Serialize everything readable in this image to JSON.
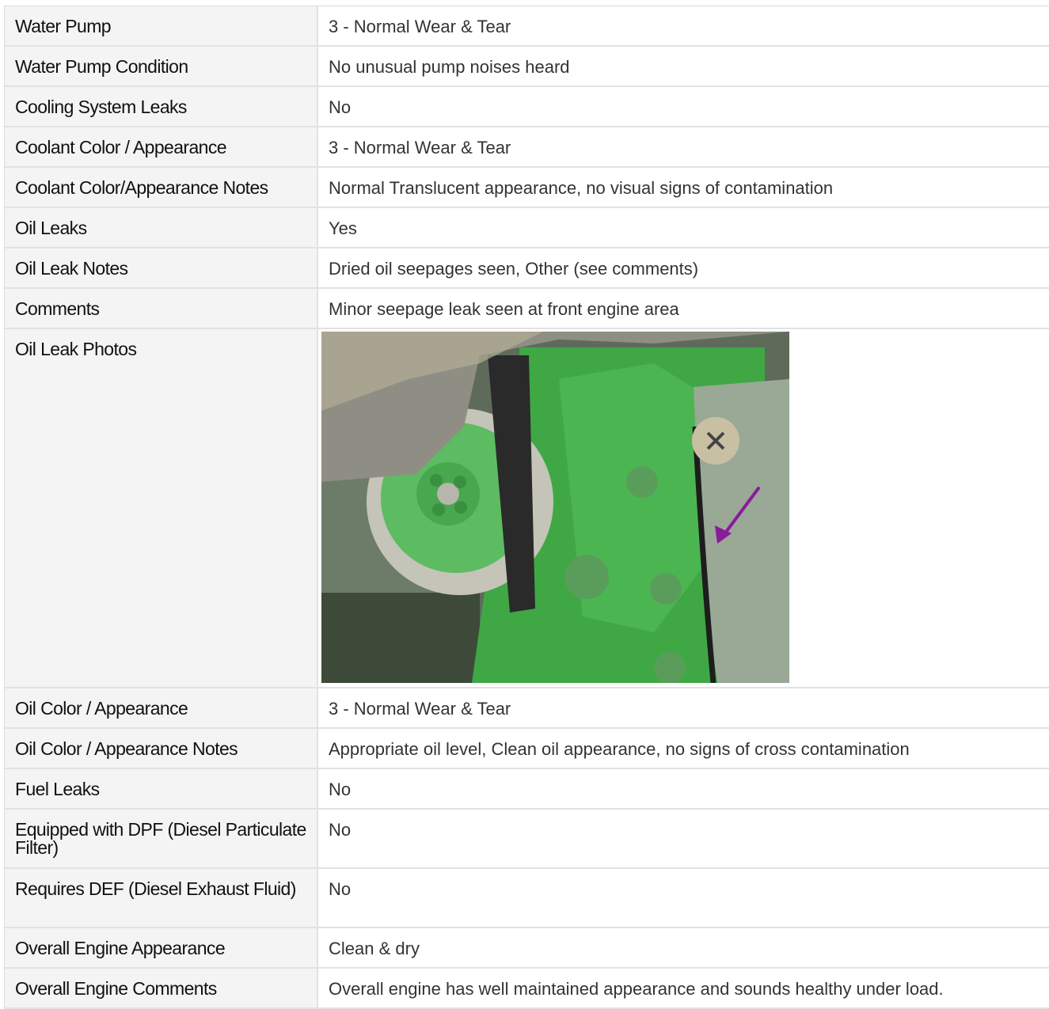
{
  "rows": [
    {
      "label": "Water Pump",
      "value": "3 - Normal Wear & Tear"
    },
    {
      "label": "Water Pump Condition",
      "value": "No unusual pump noises heard"
    },
    {
      "label": "Cooling System Leaks",
      "value": "No"
    },
    {
      "label": "Coolant Color / Appearance",
      "value": "3 - Normal Wear & Tear"
    },
    {
      "label": "Coolant Color/Appearance Notes",
      "value": "Normal Translucent appearance, no visual signs of contamination"
    },
    {
      "label": "Oil Leaks",
      "value": "Yes"
    },
    {
      "label": "Oil Leak Notes",
      "value": "Dried oil seepages seen, Other (see comments)"
    },
    {
      "label": "Comments",
      "value": "Minor seepage leak seen at front engine area"
    },
    {
      "label": "Oil Leak Photos",
      "photo": "engine-oil-leak-photo"
    },
    {
      "label": "Oil Color / Appearance",
      "value": "3 - Normal Wear & Tear"
    },
    {
      "label": "Oil Color / Appearance Notes",
      "value": "Appropriate oil level, Clean oil appearance, no signs of cross contamination"
    },
    {
      "label": "Fuel Leaks",
      "value": "No"
    },
    {
      "label": "Equipped with DPF (Diesel Particulate Filter)",
      "value": "No"
    },
    {
      "label": "Requires DEF (Diesel Exhaust Fluid)",
      "value": "No"
    },
    {
      "label": "Overall Engine Appearance",
      "value": "Clean & dry"
    },
    {
      "label": "Overall Engine Comments",
      "value": "Overall engine has well maintained appearance and sounds healthy under load."
    }
  ],
  "colors": {
    "label_bg": "#f4f4f4",
    "border": "#e2e2e2",
    "engine_green": "#3fa845",
    "arrow": "#8b1a9c"
  }
}
